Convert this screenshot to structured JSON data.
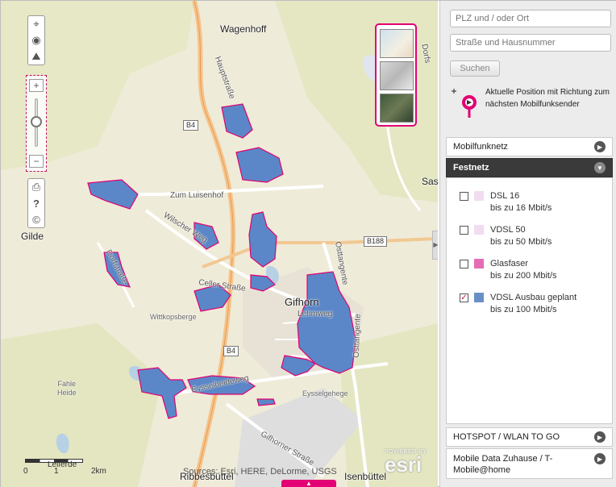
{
  "map": {
    "labels": {
      "wagenhoff": "Wagenhoff",
      "gilde": "Gilde",
      "gifhorn": "Gifhorn",
      "lehmweg": "Lehmweg",
      "wittkopsberge": "Wittkopsberge",
      "fahle_heide": "Fahle\nHeide",
      "eysselgehege": "Eysselgehege",
      "ribbesbuettel": "Ribbesbüttel",
      "isenbuettel": "Isenbüttel",
      "sas": "Sas",
      "dorfstr": "Dorfs"
    },
    "roads": {
      "hauptstrasse": "Hauptstraße",
      "zum_luisenhof": "Zum Luisenhof",
      "wilscher_weg": "Wilscher Weg",
      "celler_strasse": "Celler Straße",
      "eysselheideweg": "Eysselheideweg",
      "gifhorner_strasse": "Gifhorner Straße",
      "osttangente": "Osttangente",
      "osttangente2": "Osttangente",
      "dorfstrasse": "Dorfstraße"
    },
    "shields": {
      "b4_top": "B4",
      "b4_bottom": "B4",
      "b188": "B188"
    },
    "scale": {
      "left_label": "0",
      "mid_label": "1",
      "right_label": "2km",
      "extra": "Leiferde"
    },
    "attribution": "Sources: Esri, HERE, DeLorme, USGS",
    "esri_powered": "POWERED BY",
    "esri_logo": "esri",
    "zoom_in": "+",
    "zoom_out": "−",
    "pull_tab": "▲"
  },
  "panel": {
    "search_postal": {
      "placeholder": "PLZ und / oder Ort"
    },
    "search_street": {
      "placeholder": "Straße und Hausnummer"
    },
    "search_button": "Suchen",
    "position_text": "Aktuelle Position mit Richtung zum nächsten Mobilfunksender",
    "accordion": {
      "mobilfunknetz": "Mobilfunknetz",
      "festnetz": "Festnetz",
      "hotspot": "HOTSPOT / WLAN TO GO",
      "mobile_data": "Mobile Data Zuhause / T-Mobile@home"
    },
    "festnetz_items": [
      {
        "name": "DSL 16",
        "speed": "bis zu 16 Mbit/s",
        "checked": false,
        "color": "#f2dcef"
      },
      {
        "name": "VDSL 50",
        "speed": "bis zu 50 Mbit/s",
        "checked": false,
        "color": "#f2dcef"
      },
      {
        "name": "Glasfaser",
        "speed": "bis zu 200 Mbit/s",
        "checked": false,
        "color": "#e66bb5"
      },
      {
        "name": "VDSL Ausbau geplant",
        "speed": "bis zu 100 Mbit/s",
        "checked": true,
        "color": "#6a8fc7"
      }
    ]
  },
  "colors": {
    "magenta": "#e20074",
    "coverage": "#5b87c8",
    "coverage_edge": "#e2006f"
  }
}
